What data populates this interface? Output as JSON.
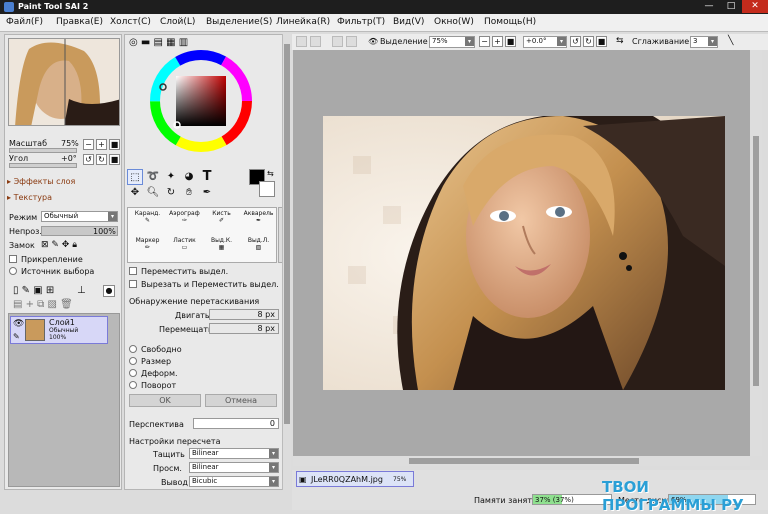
{
  "window": {
    "title": "Paint Tool SAI 2"
  },
  "menu": [
    "Файл(F)",
    "Правка(E)",
    "Холст(C)",
    "Слой(L)",
    "Выделение(S)",
    "Линейка(R)",
    "Фильтр(T)",
    "Вид(V)",
    "Окно(W)",
    "Помощь(H)"
  ],
  "navigator": {
    "scale_label": "Масштаб",
    "scale_value": "75%",
    "angle_label": "Угол",
    "angle_value": "+0°"
  },
  "sections": {
    "layer_effects": "Эффекты слоя",
    "texture": "Текстура"
  },
  "layer_props": {
    "mode_label": "Режим",
    "mode_value": "Обычный",
    "opacity_label": "Непроз.",
    "opacity_value": "100%",
    "lock_label": "Замок",
    "clip_label": "Прикрепление",
    "source_label": "Источник выбора"
  },
  "layer": {
    "name": "Слой1",
    "mode": "Обычный",
    "opacity": "100%"
  },
  "brushes": [
    {
      "label": "Каранд."
    },
    {
      "label": "Аэрограф"
    },
    {
      "label": "Кисть"
    },
    {
      "label": "Акварель"
    },
    {
      "label": "Маркер"
    },
    {
      "label": "Ластик"
    },
    {
      "label": "Выд.К."
    },
    {
      "label": "Выд.Л."
    }
  ],
  "selection_tool": {
    "move_sel": "Переместить выдел.",
    "cut_move": "Вырезать и Переместить выдел.",
    "drag_detect": "Обнаружение перетаскивания",
    "move_label": "Двигать",
    "move_value": "8 px",
    "shift_label": "Перемещать",
    "shift_value": "8 px",
    "free": "Свободно",
    "size": "Размер",
    "deform": "Деформ.",
    "rotate": "Поворот",
    "ok": "OK",
    "cancel": "Отмена",
    "perspective_label": "Перспектива",
    "perspective_value": "0",
    "resample_label": "Настройки пересчета",
    "drag_label": "Тащить",
    "drag_value": "Bilinear",
    "view_label": "Просм.",
    "view_value": "Bilinear",
    "output_label": "Вывод",
    "output_value": "Bicubic"
  },
  "canvas_toolbar": {
    "selection_label": "Выделение",
    "zoom_value": "75%",
    "angle_value": "+0.0°",
    "smoothing_label": "Сглаживание",
    "smoothing_value": "3"
  },
  "document_tab": {
    "name": "JLeRR0QZAhM.jpg",
    "zoom": "75%"
  },
  "status": {
    "memory_label": "Памяти занято",
    "memory_value": "37% (37%)",
    "memory_fraction": 0.37,
    "disk_label": "Место диска",
    "disk_value": "69%",
    "disk_fraction": 0.69
  },
  "watermark": "ТВОИ ПРОГРАММЫ РУ"
}
